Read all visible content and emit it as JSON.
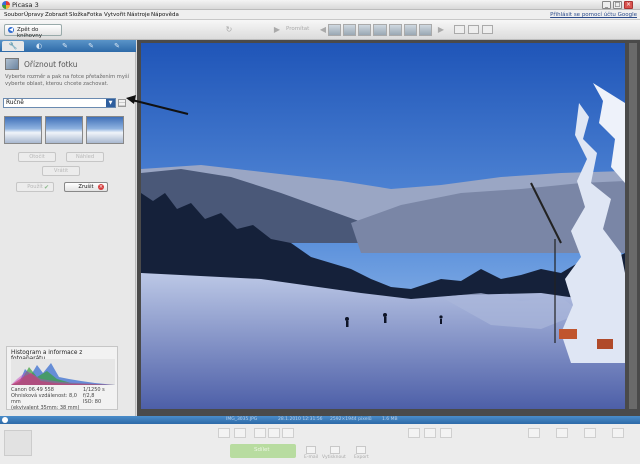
{
  "window": {
    "title": "Picasa 3",
    "controls": [
      "_",
      "□",
      "×"
    ]
  },
  "menu": {
    "items": [
      "Soubor",
      "Úpravy",
      "Zobrazit",
      "Složka",
      "Fotka",
      "Vytvořit",
      "Nástroje",
      "Nápověda"
    ],
    "help_link": "Přihlásit se pomocí účtu Google"
  },
  "toolbar": {
    "back_label": "Zpět do knihovny",
    "play_label": "Promítat"
  },
  "panel": {
    "tabs": [
      "wrench-icon",
      "tuning-icon",
      "brush-icon",
      "effects-icon",
      "effects-2-icon"
    ],
    "crop_title": "Oříznout fotku",
    "crop_hint": "Vyberte rozměr a pak na fotce přetažením myší vyberte oblast, kterou chcete zachovat.",
    "aspect_select": "Ručně",
    "buttons": {
      "rotate": "Otočit",
      "apply_preview": "Náhled",
      "reset": "Vrátit",
      "apply": "Použít",
      "cancel": "Zrušit"
    }
  },
  "histogram": {
    "title": "Histogram a informace z fotoaparátu",
    "left_lines": [
      "Canon 06.49 558",
      "Ohnisková vzdálenost: 8,0",
      "mm",
      "(ekvivalent 35mm: 38 mm)"
    ],
    "right_lines": [
      "1/1250 s",
      "f/2,8",
      "ISO: 80"
    ]
  },
  "statusbar": {
    "info": [
      "IMG_3035.JPG",
      "28.1.2010 12:31:56",
      "2592×1944 pixelů",
      "1.6 MB"
    ]
  },
  "tray": {
    "share_label": "Sdílet",
    "icons": [
      "E-mail",
      "Vytisknout",
      "Export"
    ]
  },
  "colors": {
    "accent": "#2e6aa8",
    "sky": "#2f63c2",
    "snow": "#dfe6f4"
  }
}
